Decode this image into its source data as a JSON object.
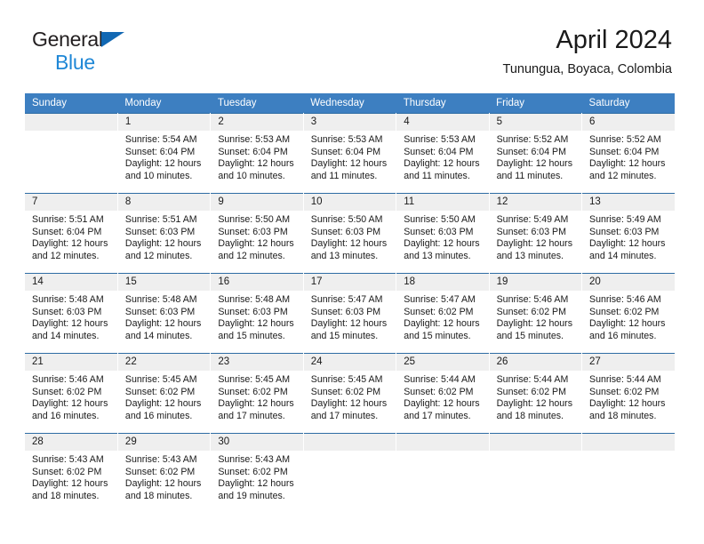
{
  "brand": {
    "name_part1": "General",
    "name_part2": "Blue",
    "triangle_icon": "triangle-icon",
    "accent_color": "#1e87d6",
    "dark_color": "#231f20"
  },
  "header": {
    "title": "April 2024",
    "subtitle": "Tunungua, Boyaca, Colombia"
  },
  "calendar": {
    "header_bg": "#3d7fc1",
    "row_border": "#2e6da4",
    "daynum_bg": "#efefef",
    "weekdays": [
      "Sunday",
      "Monday",
      "Tuesday",
      "Wednesday",
      "Thursday",
      "Friday",
      "Saturday"
    ],
    "weeks": [
      [
        {
          "day": "",
          "sunrise": "",
          "sunset": "",
          "daylight_line1": "",
          "daylight_line2": ""
        },
        {
          "day": "1",
          "sunrise": "Sunrise: 5:54 AM",
          "sunset": "Sunset: 6:04 PM",
          "daylight_line1": "Daylight: 12 hours",
          "daylight_line2": "and 10 minutes."
        },
        {
          "day": "2",
          "sunrise": "Sunrise: 5:53 AM",
          "sunset": "Sunset: 6:04 PM",
          "daylight_line1": "Daylight: 12 hours",
          "daylight_line2": "and 10 minutes."
        },
        {
          "day": "3",
          "sunrise": "Sunrise: 5:53 AM",
          "sunset": "Sunset: 6:04 PM",
          "daylight_line1": "Daylight: 12 hours",
          "daylight_line2": "and 11 minutes."
        },
        {
          "day": "4",
          "sunrise": "Sunrise: 5:53 AM",
          "sunset": "Sunset: 6:04 PM",
          "daylight_line1": "Daylight: 12 hours",
          "daylight_line2": "and 11 minutes."
        },
        {
          "day": "5",
          "sunrise": "Sunrise: 5:52 AM",
          "sunset": "Sunset: 6:04 PM",
          "daylight_line1": "Daylight: 12 hours",
          "daylight_line2": "and 11 minutes."
        },
        {
          "day": "6",
          "sunrise": "Sunrise: 5:52 AM",
          "sunset": "Sunset: 6:04 PM",
          "daylight_line1": "Daylight: 12 hours",
          "daylight_line2": "and 12 minutes."
        }
      ],
      [
        {
          "day": "7",
          "sunrise": "Sunrise: 5:51 AM",
          "sunset": "Sunset: 6:04 PM",
          "daylight_line1": "Daylight: 12 hours",
          "daylight_line2": "and 12 minutes."
        },
        {
          "day": "8",
          "sunrise": "Sunrise: 5:51 AM",
          "sunset": "Sunset: 6:03 PM",
          "daylight_line1": "Daylight: 12 hours",
          "daylight_line2": "and 12 minutes."
        },
        {
          "day": "9",
          "sunrise": "Sunrise: 5:50 AM",
          "sunset": "Sunset: 6:03 PM",
          "daylight_line1": "Daylight: 12 hours",
          "daylight_line2": "and 12 minutes."
        },
        {
          "day": "10",
          "sunrise": "Sunrise: 5:50 AM",
          "sunset": "Sunset: 6:03 PM",
          "daylight_line1": "Daylight: 12 hours",
          "daylight_line2": "and 13 minutes."
        },
        {
          "day": "11",
          "sunrise": "Sunrise: 5:50 AM",
          "sunset": "Sunset: 6:03 PM",
          "daylight_line1": "Daylight: 12 hours",
          "daylight_line2": "and 13 minutes."
        },
        {
          "day": "12",
          "sunrise": "Sunrise: 5:49 AM",
          "sunset": "Sunset: 6:03 PM",
          "daylight_line1": "Daylight: 12 hours",
          "daylight_line2": "and 13 minutes."
        },
        {
          "day": "13",
          "sunrise": "Sunrise: 5:49 AM",
          "sunset": "Sunset: 6:03 PM",
          "daylight_line1": "Daylight: 12 hours",
          "daylight_line2": "and 14 minutes."
        }
      ],
      [
        {
          "day": "14",
          "sunrise": "Sunrise: 5:48 AM",
          "sunset": "Sunset: 6:03 PM",
          "daylight_line1": "Daylight: 12 hours",
          "daylight_line2": "and 14 minutes."
        },
        {
          "day": "15",
          "sunrise": "Sunrise: 5:48 AM",
          "sunset": "Sunset: 6:03 PM",
          "daylight_line1": "Daylight: 12 hours",
          "daylight_line2": "and 14 minutes."
        },
        {
          "day": "16",
          "sunrise": "Sunrise: 5:48 AM",
          "sunset": "Sunset: 6:03 PM",
          "daylight_line1": "Daylight: 12 hours",
          "daylight_line2": "and 15 minutes."
        },
        {
          "day": "17",
          "sunrise": "Sunrise: 5:47 AM",
          "sunset": "Sunset: 6:03 PM",
          "daylight_line1": "Daylight: 12 hours",
          "daylight_line2": "and 15 minutes."
        },
        {
          "day": "18",
          "sunrise": "Sunrise: 5:47 AM",
          "sunset": "Sunset: 6:02 PM",
          "daylight_line1": "Daylight: 12 hours",
          "daylight_line2": "and 15 minutes."
        },
        {
          "day": "19",
          "sunrise": "Sunrise: 5:46 AM",
          "sunset": "Sunset: 6:02 PM",
          "daylight_line1": "Daylight: 12 hours",
          "daylight_line2": "and 15 minutes."
        },
        {
          "day": "20",
          "sunrise": "Sunrise: 5:46 AM",
          "sunset": "Sunset: 6:02 PM",
          "daylight_line1": "Daylight: 12 hours",
          "daylight_line2": "and 16 minutes."
        }
      ],
      [
        {
          "day": "21",
          "sunrise": "Sunrise: 5:46 AM",
          "sunset": "Sunset: 6:02 PM",
          "daylight_line1": "Daylight: 12 hours",
          "daylight_line2": "and 16 minutes."
        },
        {
          "day": "22",
          "sunrise": "Sunrise: 5:45 AM",
          "sunset": "Sunset: 6:02 PM",
          "daylight_line1": "Daylight: 12 hours",
          "daylight_line2": "and 16 minutes."
        },
        {
          "day": "23",
          "sunrise": "Sunrise: 5:45 AM",
          "sunset": "Sunset: 6:02 PM",
          "daylight_line1": "Daylight: 12 hours",
          "daylight_line2": "and 17 minutes."
        },
        {
          "day": "24",
          "sunrise": "Sunrise: 5:45 AM",
          "sunset": "Sunset: 6:02 PM",
          "daylight_line1": "Daylight: 12 hours",
          "daylight_line2": "and 17 minutes."
        },
        {
          "day": "25",
          "sunrise": "Sunrise: 5:44 AM",
          "sunset": "Sunset: 6:02 PM",
          "daylight_line1": "Daylight: 12 hours",
          "daylight_line2": "and 17 minutes."
        },
        {
          "day": "26",
          "sunrise": "Sunrise: 5:44 AM",
          "sunset": "Sunset: 6:02 PM",
          "daylight_line1": "Daylight: 12 hours",
          "daylight_line2": "and 18 minutes."
        },
        {
          "day": "27",
          "sunrise": "Sunrise: 5:44 AM",
          "sunset": "Sunset: 6:02 PM",
          "daylight_line1": "Daylight: 12 hours",
          "daylight_line2": "and 18 minutes."
        }
      ],
      [
        {
          "day": "28",
          "sunrise": "Sunrise: 5:43 AM",
          "sunset": "Sunset: 6:02 PM",
          "daylight_line1": "Daylight: 12 hours",
          "daylight_line2": "and 18 minutes."
        },
        {
          "day": "29",
          "sunrise": "Sunrise: 5:43 AM",
          "sunset": "Sunset: 6:02 PM",
          "daylight_line1": "Daylight: 12 hours",
          "daylight_line2": "and 18 minutes."
        },
        {
          "day": "30",
          "sunrise": "Sunrise: 5:43 AM",
          "sunset": "Sunset: 6:02 PM",
          "daylight_line1": "Daylight: 12 hours",
          "daylight_line2": "and 19 minutes."
        },
        {
          "day": "",
          "sunrise": "",
          "sunset": "",
          "daylight_line1": "",
          "daylight_line2": ""
        },
        {
          "day": "",
          "sunrise": "",
          "sunset": "",
          "daylight_line1": "",
          "daylight_line2": ""
        },
        {
          "day": "",
          "sunrise": "",
          "sunset": "",
          "daylight_line1": "",
          "daylight_line2": ""
        },
        {
          "day": "",
          "sunrise": "",
          "sunset": "",
          "daylight_line1": "",
          "daylight_line2": ""
        }
      ]
    ]
  }
}
